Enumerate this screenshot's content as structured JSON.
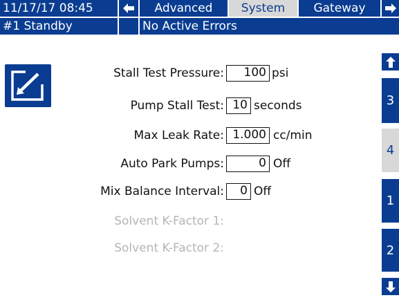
{
  "header": {
    "datetime": "11/17/17 08:45",
    "tabs": [
      "Advanced",
      "System",
      "Gateway"
    ],
    "active_tab": "System",
    "status": "#1 Standby",
    "errors": "No Active Errors"
  },
  "form": {
    "stall_test_pressure": {
      "label": "Stall Test Pressure:",
      "value": "100",
      "unit": "psi"
    },
    "pump_stall_test": {
      "label": "Pump Stall Test:",
      "value": "10",
      "unit": "seconds"
    },
    "max_leak_rate": {
      "label": "Max Leak Rate:",
      "value": "1.000",
      "unit": "cc/min"
    },
    "auto_park_pumps": {
      "label": "Auto Park Pumps:",
      "value": "0",
      "unit": "Off"
    },
    "mix_balance_interval": {
      "label": "Mix Balance Interval:",
      "value": "0",
      "unit": "Off"
    },
    "solvent_k_factor_1": {
      "label": "Solvent K-Factor 1:"
    },
    "solvent_k_factor_2": {
      "label": "Solvent K-Factor 2:"
    }
  },
  "side_nav": {
    "pages": [
      "3",
      "4",
      "1",
      "2"
    ],
    "active_page": "4"
  },
  "colors": {
    "primary": "#0a3d91",
    "tab_active_bg": "#d8d8d8",
    "disabled_text": "#b5b5b5"
  },
  "icons": [
    "left-arrow-icon",
    "right-arrow-icon",
    "edit-icon",
    "up-arrow-icon",
    "down-arrow-icon"
  ]
}
